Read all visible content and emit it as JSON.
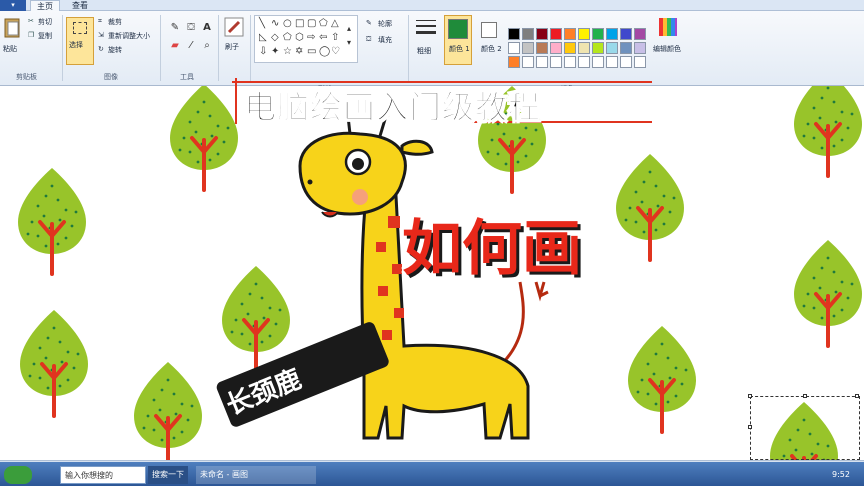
{
  "ribbon": {
    "tabs": [
      "主页",
      "查看"
    ],
    "clipboard": {
      "paste": "粘贴",
      "cut": "剪切",
      "copy": "复制",
      "group": "剪贴板"
    },
    "image": {
      "select": "选择",
      "crop": "裁剪",
      "resize": "重新调整大小",
      "rotate": "旋转",
      "group": "图像"
    },
    "tools": {
      "group": "工具"
    },
    "brushes": {
      "label": "刷子"
    },
    "shapes": {
      "outline": "轮廓",
      "fill": "填充",
      "group": "形状"
    },
    "size": {
      "label": "粗细"
    },
    "colors": {
      "color1": "颜色 1",
      "color2": "颜色 2",
      "edit": "编辑颜色",
      "group": "颜色",
      "color1_value": "#1f8b3a",
      "color2_value": "#ffffff",
      "palette": [
        "#000000",
        "#7f7f7f",
        "#880015",
        "#ed1c24",
        "#ff7f27",
        "#fff200",
        "#22b14c",
        "#00a2e8",
        "#3f48cc",
        "#a349a4",
        "#ffffff",
        "#c3c3c3",
        "#b97a57",
        "#ffaec9",
        "#ffc90e",
        "#efe4b0",
        "#b5e61d",
        "#99d9ea",
        "#7092be",
        "#c8bfe7"
      ]
    }
  },
  "overlay": {
    "title": "电脑绘画入门级教程",
    "howto": "如何画",
    "subject": "长颈鹿"
  },
  "taskbar": {
    "search": "输入你想搜的",
    "search_button": "搜索一下",
    "app": "未命名 - 画图",
    "clock": "9:52"
  },
  "icons": [
    "paste-icon",
    "cut-icon",
    "copy-icon",
    "select-icon",
    "crop-icon",
    "resize-icon",
    "rotate-icon",
    "pencil-icon",
    "fill-icon",
    "text-icon",
    "eraser-icon",
    "picker-icon",
    "magnifier-icon",
    "brush-icon",
    "size-icon",
    "edit-colors-icon"
  ]
}
